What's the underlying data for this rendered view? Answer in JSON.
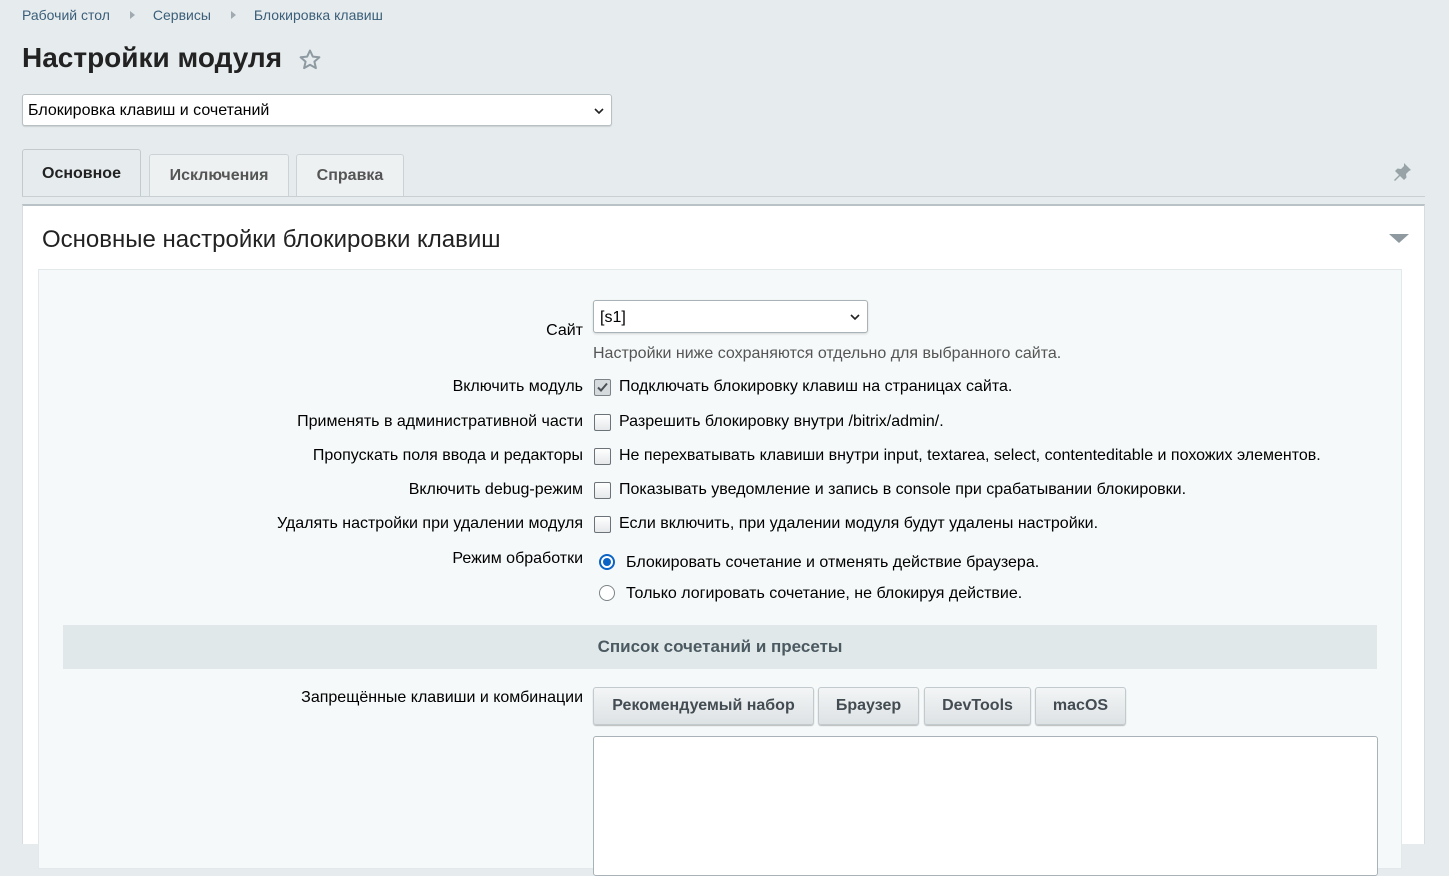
{
  "breadcrumb": [
    "Рабочий стол",
    "Сервисы",
    "Блокировка клавиш"
  ],
  "page_title": "Настройки модуля",
  "module_select": {
    "value": "Блокировка клавиш и сочетаний"
  },
  "tabs": [
    {
      "label": "Основное",
      "active": true
    },
    {
      "label": "Исключения",
      "active": false
    },
    {
      "label": "Справка",
      "active": false
    }
  ],
  "section": {
    "title": "Основные настройки блокировки клавиш",
    "site": {
      "label": "Сайт",
      "value": "[s1]",
      "hint": "Настройки ниже сохраняются отдельно для выбранного сайта."
    },
    "options": [
      {
        "label": "Включить модуль",
        "text": "Подключать блокировку клавиш на страницах сайта.",
        "checked": true
      },
      {
        "label": "Применять в административной части",
        "text": "Разрешить блокировку внутри /bitrix/admin/.",
        "checked": false
      },
      {
        "label": "Пропускать поля ввода и редакторы",
        "text": "Не перехватывать клавиши внутри input, textarea, select, contenteditable и похожих элементов.",
        "checked": false
      },
      {
        "label": "Включить debug-режим",
        "text": "Показывать уведомление и запись в console при срабатывании блокировки.",
        "checked": false
      },
      {
        "label": "Удалять настройки при удалении модуля",
        "text": "Если включить, при удалении модуля будут удалены настройки.",
        "checked": false
      }
    ],
    "mode": {
      "label": "Режим обработки",
      "options": [
        {
          "text": "Блокировать сочетание и отменять действие браузера.",
          "selected": true
        },
        {
          "text": "Только логировать сочетание, не блокируя действие.",
          "selected": false
        }
      ]
    },
    "combos": {
      "header": "Список сочетаний и пресеты",
      "label": "Запрещённые клавиши и комбинации",
      "presets": [
        "Рекомендуемый набор",
        "Браузер",
        "DevTools",
        "macOS"
      ],
      "value": ""
    }
  },
  "colors": {
    "accent": "#0b63c5",
    "link": "#3b5e79",
    "background": "#e6ecee"
  }
}
